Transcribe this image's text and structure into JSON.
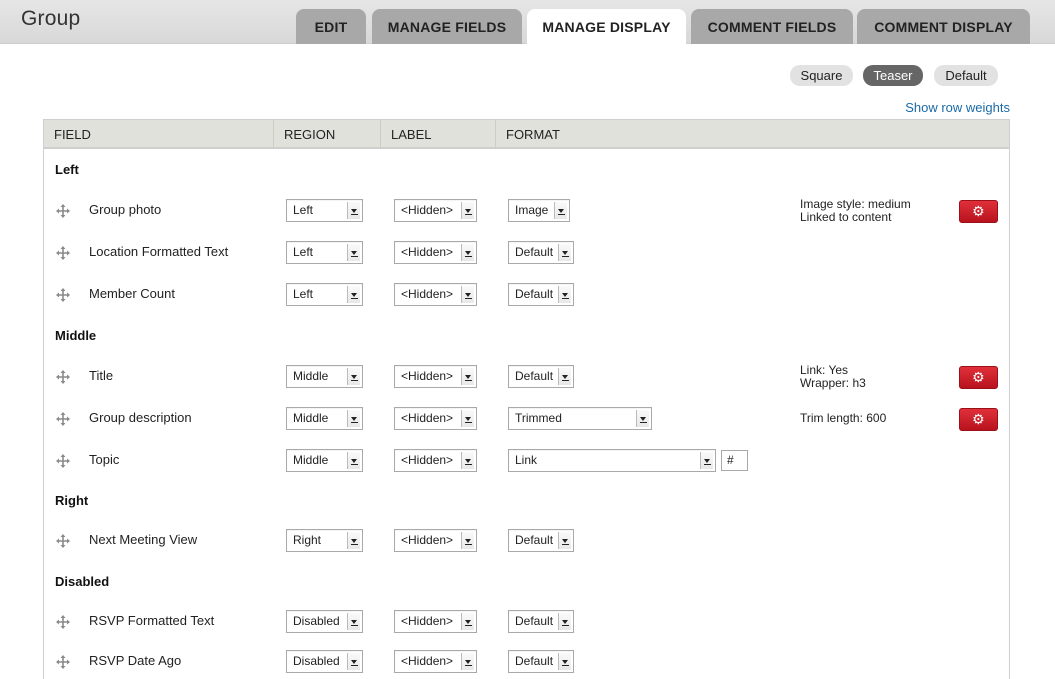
{
  "page": {
    "title": "Group"
  },
  "tabs": [
    {
      "label": "Edit"
    },
    {
      "label": "Manage fields"
    },
    {
      "label": "Manage display"
    },
    {
      "label": "Comment fields"
    },
    {
      "label": "Comment display"
    }
  ],
  "view_modes": [
    {
      "label": "Square"
    },
    {
      "label": "Teaser"
    },
    {
      "label": "Default"
    }
  ],
  "row_weights_link": "Show row weights",
  "table": {
    "headers": [
      "FIELD",
      "REGION",
      "LABEL",
      "FORMAT"
    ],
    "regions": [
      "Left",
      "Middle",
      "Right",
      "Disabled"
    ],
    "rows": [
      {
        "name": "Group photo",
        "region": "Left",
        "label": "<Hidden>",
        "format": "Image",
        "summary1": "Image style: medium",
        "summary2": "Linked to content"
      },
      {
        "name": "Location Formatted Text",
        "region": "Left",
        "label": "<Hidden>",
        "format": "Default"
      },
      {
        "name": "Member Count",
        "region": "Left",
        "label": "<Hidden>",
        "format": "Default"
      },
      {
        "name": "Title",
        "region": "Middle",
        "label": "<Hidden>",
        "format": "Default",
        "summary1": "Link: Yes",
        "summary2": "Wrapper: h3"
      },
      {
        "name": "Group description",
        "region": "Middle",
        "label": "<Hidden>",
        "format": "Trimmed",
        "summary1": "Trim length: 600"
      },
      {
        "name": "Topic",
        "region": "Middle",
        "label": "<Hidden>",
        "format": "Link",
        "extra": "#"
      },
      {
        "name": "Next Meeting View",
        "region": "Right",
        "label": "<Hidden>",
        "format": "Default"
      },
      {
        "name": "RSVP Formatted Text",
        "region": "Disabled",
        "label": "<Hidden>",
        "format": "Default"
      },
      {
        "name": "RSVP Date Ago",
        "region": "Disabled",
        "label": "<Hidden>",
        "format": "Default"
      }
    ]
  },
  "colors": {
    "accent_button": "#c8141f",
    "link": "#1a6aa6",
    "tab_inactive": "#a8a8a8",
    "header_bg": "#e1e1dc"
  },
  "icons": {
    "drag": "move-arrows-icon",
    "settings": "gear-icon"
  }
}
